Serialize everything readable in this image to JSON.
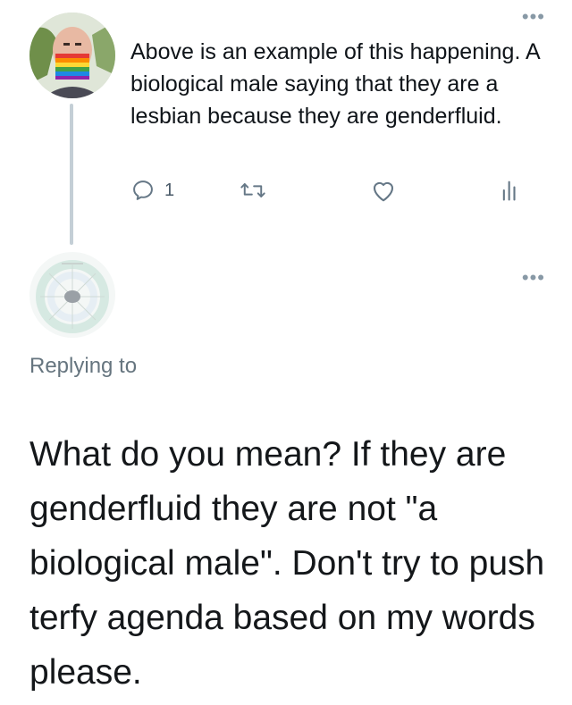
{
  "tweet": {
    "text": "Above is an example of this happening. A biological male saying that they are a lesbian because they are genderfluid.",
    "actions": {
      "reply_count": "1"
    },
    "menu_icon": "more-icon"
  },
  "reply": {
    "replying_to_label": "Replying to",
    "text": "What do you mean? If they are genderfluid they are not \"a biological male\". Don't try to push terfy agenda based on my words please.",
    "menu_icon": "more-icon"
  },
  "colors": {
    "icon_gray": "#657786",
    "thread_line": "#c4cfd6",
    "secondary_text": "#66757f"
  }
}
